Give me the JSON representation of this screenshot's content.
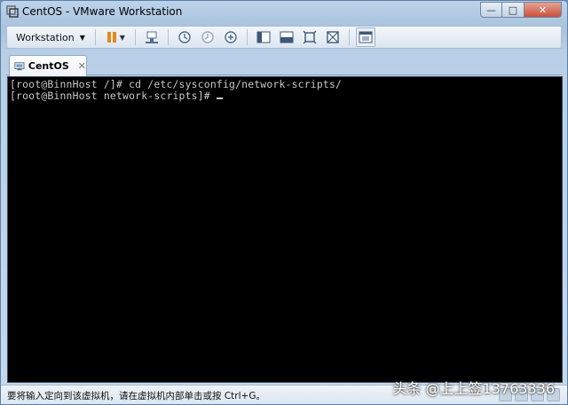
{
  "window": {
    "title": "CentOS - VMware Workstation",
    "controls": {
      "minimize": "—",
      "maximize": "□",
      "close": "✕"
    }
  },
  "toolbar": {
    "menu_label": "Workstation",
    "icons": [
      "pause-icon",
      "send-ctrl-alt-del-icon",
      "snapshot-take-icon",
      "snapshot-revert-icon",
      "snapshot-manager-icon",
      "sidebar-toggle-icon",
      "console-view-icon",
      "fullscreen-icon",
      "unity-icon",
      "thumbnail-view-icon"
    ]
  },
  "tabs": [
    {
      "label": "CentOS",
      "close": "✕"
    }
  ],
  "terminal": {
    "lines": [
      "[root@BinnHost /]# cd /etc/sysconfig/network-scripts/",
      "[root@BinnHost network-scripts]# "
    ]
  },
  "status": {
    "text": "要将输入定向到该虚拟机，请在虚拟机内部单击或按 Ctrl+G。"
  },
  "watermark": "头条 @上上签13763336",
  "colors": {
    "console_bg": "#000000",
    "console_fg": "#c8c8c8",
    "accent_pause": "#e0891c"
  }
}
